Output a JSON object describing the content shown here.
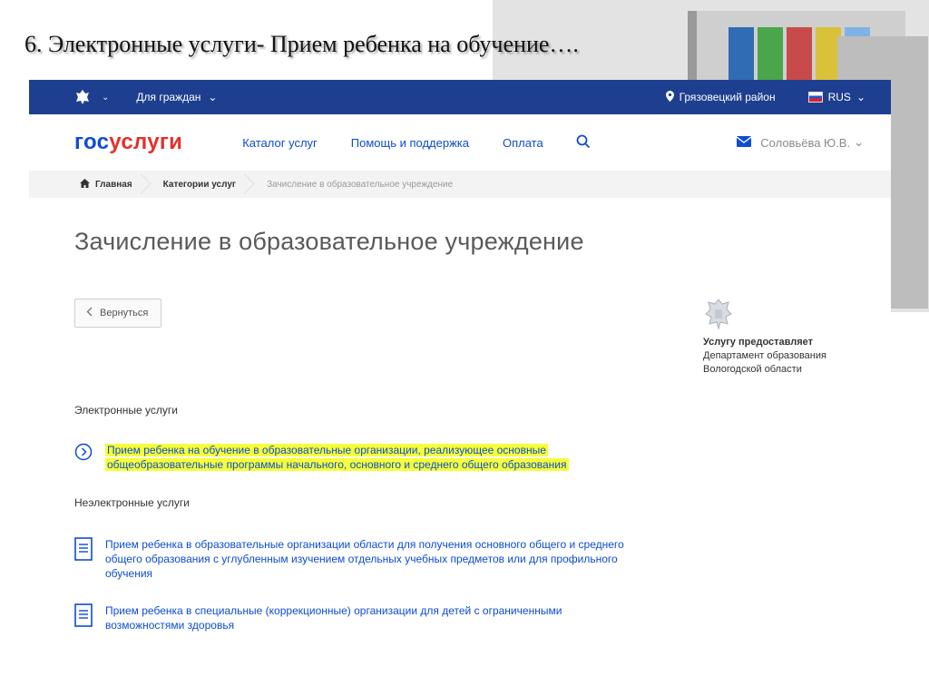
{
  "slide_title": "6. Электронные услуги- Прием ребенка на обучение….",
  "topbar": {
    "for_citizens": "Для граждан",
    "region": "Грязовецкий район",
    "lang": "RUS"
  },
  "header": {
    "logo_part1": "гос",
    "logo_part2": "услуги",
    "nav": [
      "Каталог услуг",
      "Помощь и поддержка",
      "Оплата"
    ],
    "user": "Соловьёва Ю.В."
  },
  "breadcrumbs": [
    "Главная",
    "Категории услуг",
    "Зачисление в образовательное учреждение"
  ],
  "page_title": "Зачисление в образовательное учреждение",
  "back_label": "Вернуться",
  "provider": {
    "label": "Услугу предоставляет",
    "line1": "Департамент образования",
    "line2": "Вологодской области"
  },
  "electronic": {
    "heading": "Электронные услуги",
    "items": [
      {
        "line1": "Прием ребенка на обучение в образовательные организации, реализующее основные",
        "line2": "общеобразовательные программы начального, основного и среднего общего образования"
      }
    ]
  },
  "non_electronic": {
    "heading": "Неэлектронные услуги",
    "items": [
      {
        "line1": "Прием ребенка в образовательные организации области для получения основного общего и среднего",
        "line2": "общего образования с углубленным изучением отдельных учебных предметов или для профильного",
        "line3": "обучения"
      },
      {
        "line1": "Прием ребенка в специальные (коррекционные) организации для детей с ограниченными",
        "line2": "возможностями здоровья"
      }
    ]
  },
  "colors": {
    "topbar": "#1e3f8f",
    "link": "#0d4cd3",
    "logo_red": "#e4312b",
    "highlight": "#f6ff39"
  }
}
